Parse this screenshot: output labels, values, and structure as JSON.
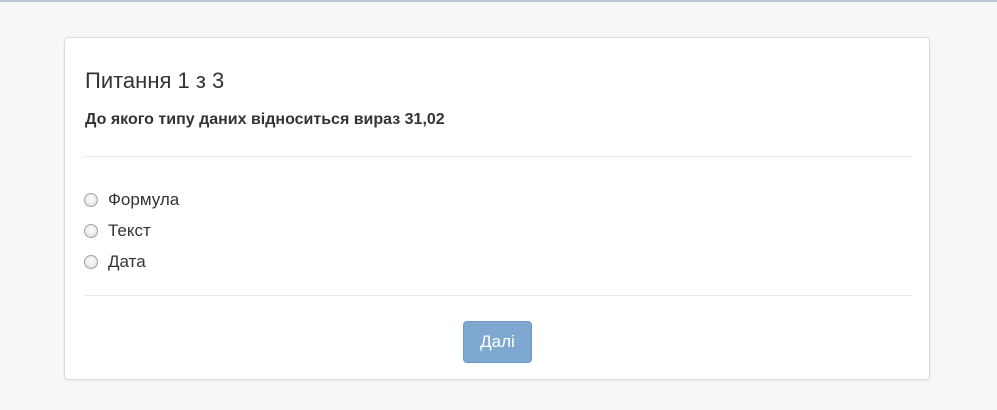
{
  "question": {
    "title": "Питання 1 з 3",
    "text": "До якого типу даних відноситься вираз 31,02"
  },
  "options": [
    {
      "label": "Формула",
      "selected": false
    },
    {
      "label": "Текст",
      "selected": false
    },
    {
      "label": "Дата",
      "selected": false
    }
  ],
  "actions": {
    "next_label": "Далі"
  },
  "colors": {
    "page_background": "#f7f7f7",
    "button_primary": "#7fa8d1"
  }
}
